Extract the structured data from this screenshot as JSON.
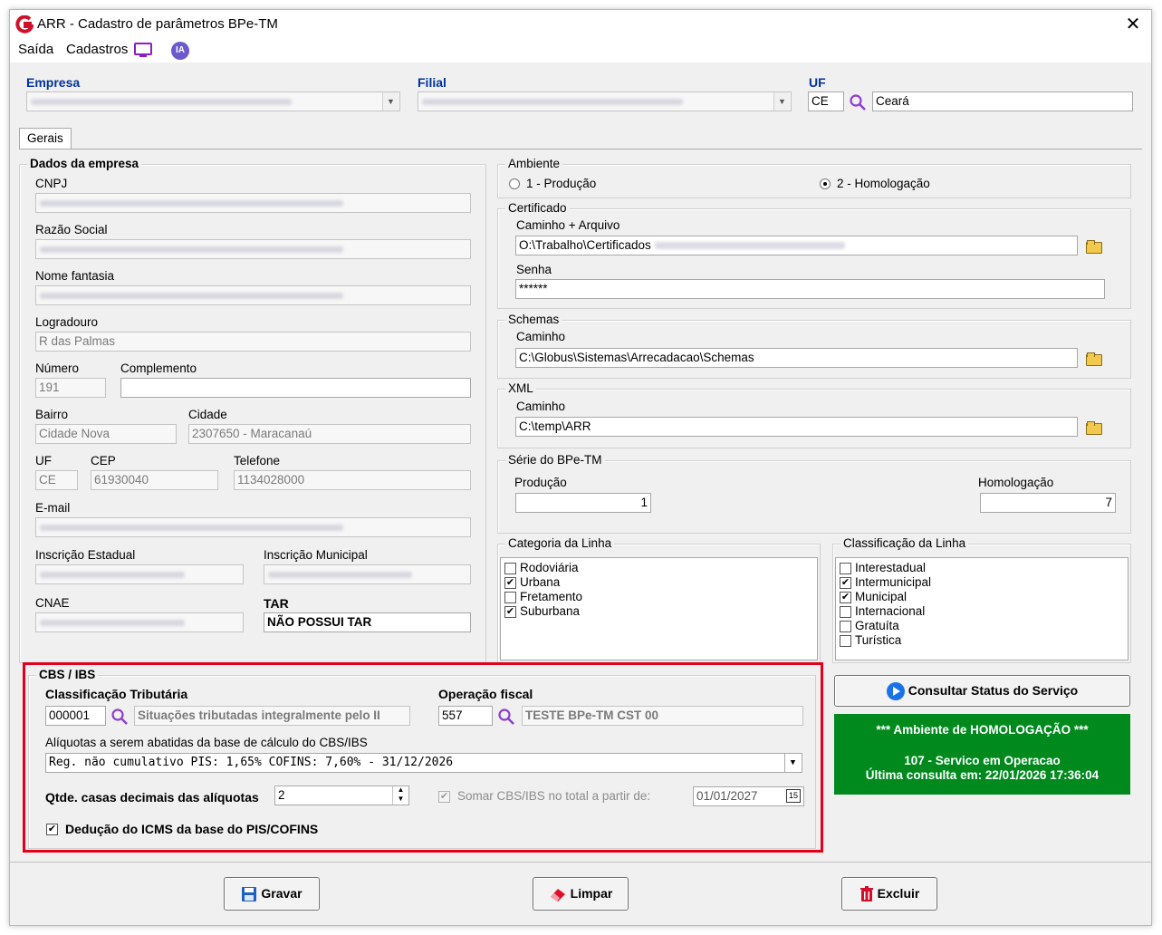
{
  "window": {
    "title": "ARR - Cadastro de parâmetros BPe-TM"
  },
  "menu": {
    "saida": "Saída",
    "cadastros": "Cadastros",
    "ia": "IA"
  },
  "header": {
    "empresa_label": "Empresa",
    "empresa_value": "",
    "filial_label": "Filial",
    "filial_value": "",
    "uf_label": "UF",
    "uf_code": "CE",
    "uf_name": "Ceará"
  },
  "tabs": [
    "Gerais"
  ],
  "dados": {
    "title": "Dados da empresa",
    "cnpj_label": "CNPJ",
    "razao_label": "Razão Social",
    "fantasia_label": "Nome fantasia",
    "logradouro_label": "Logradouro",
    "logradouro": "R das Palmas",
    "numero_label": "Número",
    "numero": "191",
    "complemento_label": "Complemento",
    "complemento": "",
    "bairro_label": "Bairro",
    "bairro": "Cidade Nova",
    "cidade_label": "Cidade",
    "cidade": "2307650 - Maracanaú",
    "uf_label": "UF",
    "uf": "CE",
    "cep_label": "CEP",
    "cep": "61930040",
    "telefone_label": "Telefone",
    "telefone": "1134028000",
    "email_label": "E-mail",
    "ie_label": "Inscrição Estadual",
    "im_label": "Inscrição Municipal",
    "cnae_label": "CNAE",
    "tar_label": "TAR",
    "tar": "NÃO POSSUI TAR"
  },
  "ambiente": {
    "title": "Ambiente",
    "opt1": "1 - Produção",
    "opt2": "2 - Homologação",
    "selected": 2
  },
  "certificado": {
    "title": "Certificado",
    "caminho_label": "Caminho + Arquivo",
    "caminho": "O:\\Trabalho\\Certificados",
    "senha_label": "Senha",
    "senha": "******"
  },
  "schemas": {
    "title": "Schemas",
    "caminho_label": "Caminho",
    "caminho": "C:\\Globus\\Sistemas\\Arrecadacao\\Schemas"
  },
  "xml": {
    "title": "XML",
    "caminho_label": "Caminho",
    "caminho": "C:\\temp\\ARR"
  },
  "serie": {
    "title": "Série do BPe-TM",
    "producao_label": "Produção",
    "producao": "1",
    "homologacao_label": "Homologação",
    "homologacao": "7"
  },
  "categoria": {
    "title": "Categoria da Linha",
    "items": [
      {
        "label": "Rodoviária",
        "checked": false
      },
      {
        "label": "Urbana",
        "checked": true
      },
      {
        "label": "Fretamento",
        "checked": false
      },
      {
        "label": "Suburbana",
        "checked": true
      }
    ]
  },
  "classificacao": {
    "title": "Classificação da Linha",
    "items": [
      {
        "label": "Interestadual",
        "checked": false
      },
      {
        "label": "Intermunicipal",
        "checked": true
      },
      {
        "label": "Municipal",
        "checked": true
      },
      {
        "label": "Internacional",
        "checked": false
      },
      {
        "label": "Gratuíta",
        "checked": false
      },
      {
        "label": "Turística",
        "checked": false
      }
    ]
  },
  "cbs": {
    "title": "CBS / IBS",
    "class_label": "Classificação Tributária",
    "class_code": "000001",
    "class_desc": "Situações tributadas integralmente pelo II",
    "op_label": "Operação fiscal",
    "op_code": "557",
    "op_desc": "TESTE BPe-TM CST 00",
    "aliquotas_label": "Alíquotas a serem abatidas da base de cálculo do CBS/IBS",
    "aliquotas_value": "Reg. não cumulativo PIS: 1,65% COFINS: 7,60% - 31/12/2026",
    "casas_label": "Qtde. casas decimais das alíquotas",
    "casas_value": "2",
    "somar_label": "Somar CBS/IBS no total a partir de:",
    "somar_checked": true,
    "somar_date": "01/01/2027",
    "deducao_label": "Dedução do ICMS da base do PIS/COFINS",
    "deducao_checked": true
  },
  "status": {
    "button_label": "Consultar Status do Serviço",
    "line1": "*** Ambiente de HOMOLOGAÇÃO ***",
    "line2": "107 - Servico em Operacao",
    "line3": "Última consulta em: 22/01/2026 17:36:04",
    "color": "#008a1e"
  },
  "footer": {
    "gravar": "Gravar",
    "limpar": "Limpar",
    "excluir": "Excluir"
  },
  "colors": {
    "highlight": "#e3001b",
    "label_blue": "#003399"
  }
}
